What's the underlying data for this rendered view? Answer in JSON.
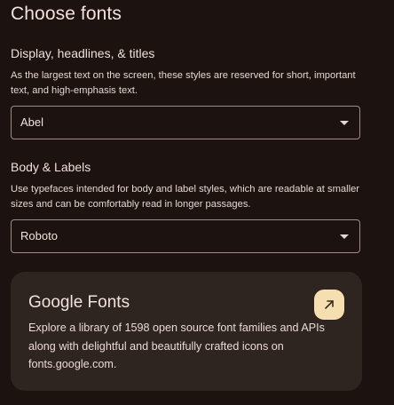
{
  "header": {
    "title": "Choose fonts"
  },
  "display_section": {
    "title": "Display, headlines, & titles",
    "description": "As the largest text on the screen, these styles are reserved for short, important text, and high-emphasis text.",
    "selected_font": "Abel"
  },
  "body_section": {
    "title": "Body & Labels",
    "description": "Use typefaces intended for body and label styles, which are readable at smaller sizes and can be comfortably read in longer passages.",
    "selected_font": "Roboto"
  },
  "google_fonts_card": {
    "title": "Google Fonts",
    "description": "Explore a library of 1598 open source font families and APIs along with delightful and beautifully crafted icons on fonts.google.com.",
    "icon": "open-in-new-icon"
  },
  "colors": {
    "background": "#1c1210",
    "card": "#2e2420",
    "accent": "#f5dfb0"
  }
}
